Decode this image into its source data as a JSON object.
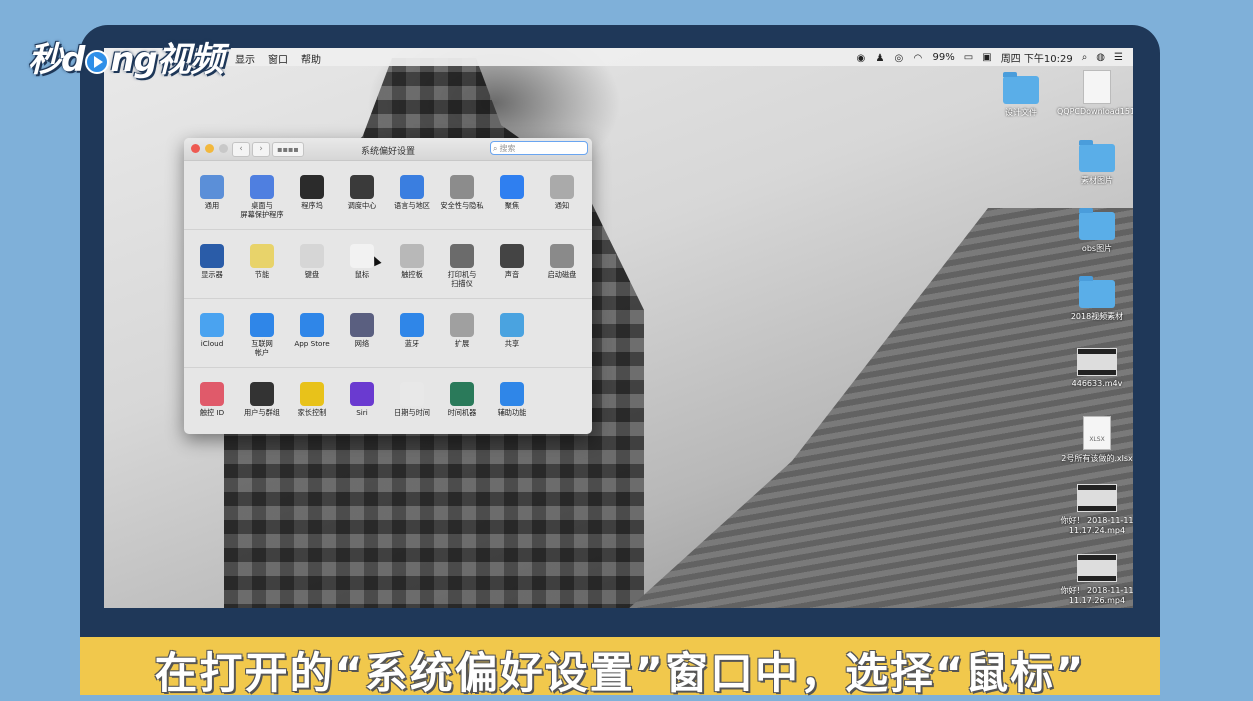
{
  "watermark": {
    "text_left": "秒d",
    "text_right": "ng视频"
  },
  "menubar": {
    "left_items": [
      "编辑",
      "显示",
      "窗口",
      "帮助"
    ],
    "battery": "99%",
    "clock": "周四 下午10:29"
  },
  "desktop": {
    "items": [
      {
        "label": "设计文件",
        "kind": "folder"
      },
      {
        "label": "QQPCDownload1519.exe",
        "kind": "doc",
        "tag": ""
      },
      {
        "label": "素材图片",
        "kind": "folder"
      },
      {
        "label": "obs图片",
        "kind": "folder"
      },
      {
        "label": "2018视频素材",
        "kind": "folder"
      },
      {
        "label": "446633.m4v",
        "kind": "video"
      },
      {
        "label": "2号所有该做的.xlsx",
        "kind": "doc",
        "tag": "XLSX"
      },
      {
        "label": "你好！ 2018-11-11 11.17.24.mp4",
        "kind": "video"
      },
      {
        "label": "你好！ 2018-11-11 11.17.26.mp4",
        "kind": "video"
      }
    ]
  },
  "prefs_window": {
    "title": "系统偏好设置",
    "search_placeholder": "搜索",
    "grid_label": "▪▪▪▪",
    "rows": [
      [
        {
          "label": "通用",
          "icon": "general-icon",
          "color": "#5b8fd8"
        },
        {
          "label": "桌面与\n屏幕保护程序",
          "icon": "desktop-icon",
          "color": "#4f7fe0"
        },
        {
          "label": "程序坞",
          "icon": "dock-icon",
          "color": "#2b2b2b"
        },
        {
          "label": "调度中心",
          "icon": "mission-control-icon",
          "color": "#3a3a3a"
        },
        {
          "label": "语言与地区",
          "icon": "language-icon",
          "color": "#3a7ee0"
        },
        {
          "label": "安全性与隐私",
          "icon": "security-icon",
          "color": "#8c8c8c"
        },
        {
          "label": "聚焦",
          "icon": "spotlight-icon",
          "color": "#2f7ff0"
        },
        {
          "label": "通知",
          "icon": "notifications-icon",
          "color": "#aaaaaa"
        }
      ],
      [
        {
          "label": "显示器",
          "icon": "display-icon",
          "color": "#2a5ca8"
        },
        {
          "label": "节能",
          "icon": "energy-icon",
          "color": "#e8d36a"
        },
        {
          "label": "键盘",
          "icon": "keyboard-icon",
          "color": "#d6d6d6"
        },
        {
          "label": "鼠标",
          "icon": "mouse-icon",
          "color": "#f2f2f2"
        },
        {
          "label": "触控板",
          "icon": "trackpad-icon",
          "color": "#b8b8b8"
        },
        {
          "label": "打印机与\n扫描仪",
          "icon": "printer-icon",
          "color": "#6b6b6b"
        },
        {
          "label": "声音",
          "icon": "sound-icon",
          "color": "#444444"
        },
        {
          "label": "启动磁盘",
          "icon": "startup-disk-icon",
          "color": "#8a8a8a"
        }
      ],
      [
        {
          "label": "iCloud",
          "icon": "icloud-icon",
          "color": "#4aa3f0"
        },
        {
          "label": "互联网\n帐户",
          "icon": "internet-accounts-icon",
          "color": "#2f86e8"
        },
        {
          "label": "App Store",
          "icon": "app-store-icon",
          "color": "#2f86e8"
        },
        {
          "label": "网络",
          "icon": "network-icon",
          "color": "#5a5f80"
        },
        {
          "label": "蓝牙",
          "icon": "bluetooth-icon",
          "color": "#2f86e8"
        },
        {
          "label": "扩展",
          "icon": "extensions-icon",
          "color": "#a0a0a0"
        },
        {
          "label": "共享",
          "icon": "sharing-icon",
          "color": "#4aa3e0"
        }
      ],
      [
        {
          "label": "触控 ID",
          "icon": "touch-id-icon",
          "color": "#e05a6a"
        },
        {
          "label": "用户与群组",
          "icon": "users-icon",
          "color": "#333333"
        },
        {
          "label": "家长控制",
          "icon": "parental-controls-icon",
          "color": "#e8c21a"
        },
        {
          "label": "Siri",
          "icon": "siri-icon",
          "color": "#6a3ad0"
        },
        {
          "label": "日期与时间",
          "icon": "date-time-icon",
          "color": "#e8e8e8"
        },
        {
          "label": "时间机器",
          "icon": "time-machine-icon",
          "color": "#2a7a5a"
        },
        {
          "label": "辅助功能",
          "icon": "accessibility-icon",
          "color": "#2f86e8"
        }
      ]
    ]
  },
  "caption": "在打开的“系统偏好设置”窗口中，选择“鼠标”"
}
